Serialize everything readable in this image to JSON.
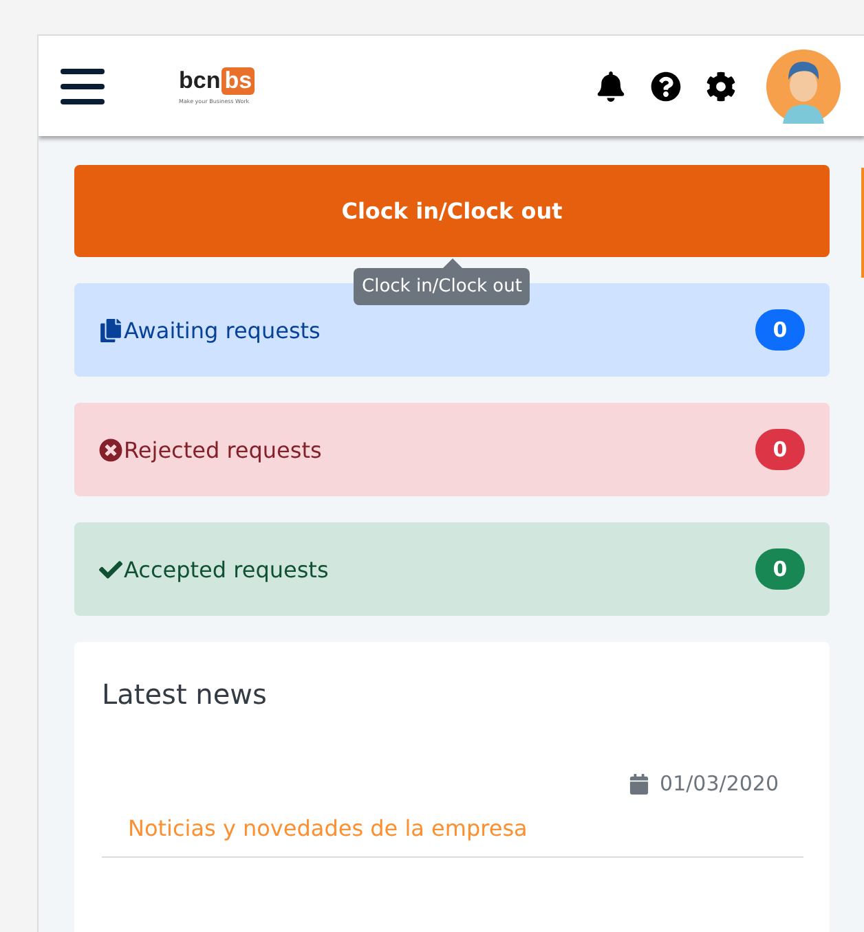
{
  "header": {
    "logo": {
      "word": "bcn",
      "mark": "bs",
      "tagline": "Make your Business Work"
    }
  },
  "clock_button": {
    "label": "Clock in/Clock out",
    "tooltip": "Clock in/Clock out"
  },
  "requests": [
    {
      "kind": "awaiting",
      "label": "Awaiting requests",
      "count": "0"
    },
    {
      "kind": "rejected",
      "label": "Rejected requests",
      "count": "0"
    },
    {
      "kind": "accepted",
      "label": "Accepted requests",
      "count": "0"
    }
  ],
  "news": {
    "title": "Latest news",
    "items": [
      {
        "date": "01/03/2020",
        "title": "Noticias y novedades de la empresa"
      }
    ]
  }
}
